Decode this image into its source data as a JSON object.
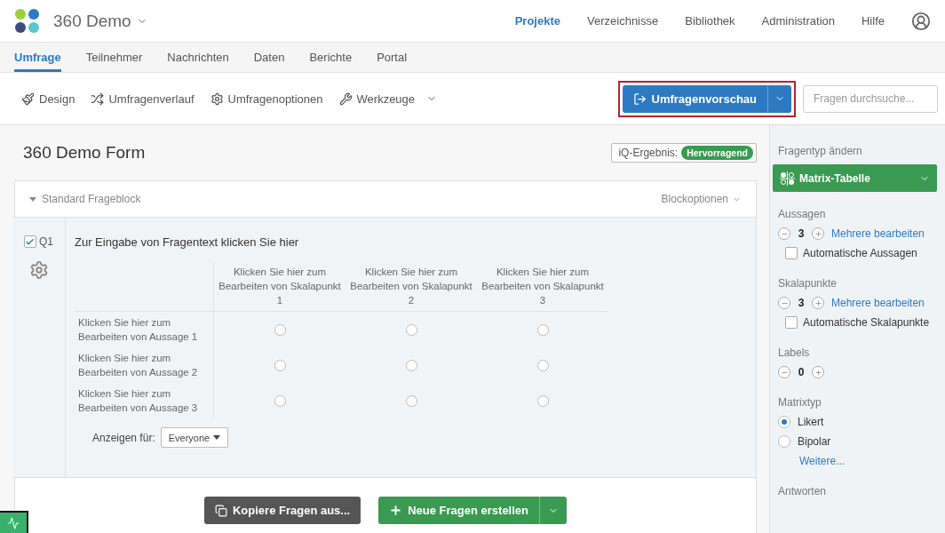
{
  "header": {
    "project_title": "360 Demo",
    "nav": [
      {
        "label": "Projekte",
        "selected": true
      },
      {
        "label": "Verzeichnisse",
        "selected": false
      },
      {
        "label": "Bibliothek",
        "selected": false
      },
      {
        "label": "Administration",
        "selected": false
      },
      {
        "label": "Hilfe",
        "selected": false
      }
    ]
  },
  "tabs": [
    {
      "label": "Umfrage",
      "selected": true
    },
    {
      "label": "Teilnehmer",
      "selected": false
    },
    {
      "label": "Nachrichten",
      "selected": false
    },
    {
      "label": "Daten",
      "selected": false
    },
    {
      "label": "Berichte",
      "selected": false
    },
    {
      "label": "Portal",
      "selected": false
    }
  ],
  "toolbar": {
    "items": [
      {
        "kind": "design",
        "label": "Design"
      },
      {
        "kind": "flow",
        "label": "Umfragenverlauf"
      },
      {
        "kind": "options",
        "label": "Umfragenoptionen"
      },
      {
        "kind": "tools",
        "label": "Werkzeuge"
      }
    ],
    "preview_button": {
      "label": "Umfragenvorschau",
      "highlighted": true
    },
    "search": {
      "placeholder": "Fragen durchsuche..."
    }
  },
  "survey": {
    "title": "360 Demo Form",
    "iq_score": {
      "label": "iQ-Ergebnis:",
      "value": "Hervorragend"
    },
    "block": {
      "title": "Standard Frageblock",
      "options": "Blockoptionen"
    },
    "question": {
      "number": "Q1",
      "checked": true,
      "text": "Zur Eingabe von Fragentext klicken Sie hier",
      "columns": [
        "Klicken Sie hier zum Bearbeiten von Skalapunkt 1",
        "Klicken Sie hier zum Bearbeiten von Skalapunkt 2",
        "Klicken Sie hier zum Bearbeiten von Skalapunkt 3"
      ],
      "rows": [
        {
          "label": "Klicken Sie hier zum Bearbeiten von Aussage 1",
          "choices": [
            {
              "selected": false
            },
            {
              "selected": false
            },
            {
              "selected": false
            }
          ]
        },
        {
          "label": "Klicken Sie hier zum Bearbeiten von Aussage 2",
          "choices": [
            {
              "selected": false
            },
            {
              "selected": false
            },
            {
              "selected": false
            }
          ]
        },
        {
          "label": "Klicken Sie hier zum Bearbeiten von Aussage 3",
          "choices": [
            {
              "selected": false
            },
            {
              "selected": false
            },
            {
              "selected": false
            }
          ]
        }
      ],
      "display_for": {
        "label": "Anzeigen für:",
        "value": "Everyone"
      }
    },
    "copy_button": "Kopiere Fragen aus...",
    "new_button": "Neue Fragen erstellen"
  },
  "sidebar": {
    "title": "Fragentyp ändern",
    "question_type": "Matrix-Tabelle",
    "sections": [
      {
        "kind": "counter",
        "title": "Aussagen",
        "count": "3",
        "link": "Mehrere bearbeiten",
        "checkbox": {
          "label": "Automatische Aussagen",
          "checked": false
        }
      },
      {
        "kind": "counter",
        "title": "Skalapunkte",
        "count": "3",
        "link": "Mehrere bearbeiten",
        "checkbox": {
          "label": "Automatische Skalapunkte",
          "checked": false
        }
      },
      {
        "kind": "counter",
        "title": "Labels",
        "count": "0"
      },
      {
        "kind": "radio",
        "title": "Matrixtyp",
        "options": [
          {
            "label": "Likert",
            "selected": true
          },
          {
            "label": "Bipolar",
            "selected": false
          }
        ],
        "link": "Weitere..."
      },
      {
        "kind": "heading",
        "title": "Antworten"
      }
    ]
  }
}
